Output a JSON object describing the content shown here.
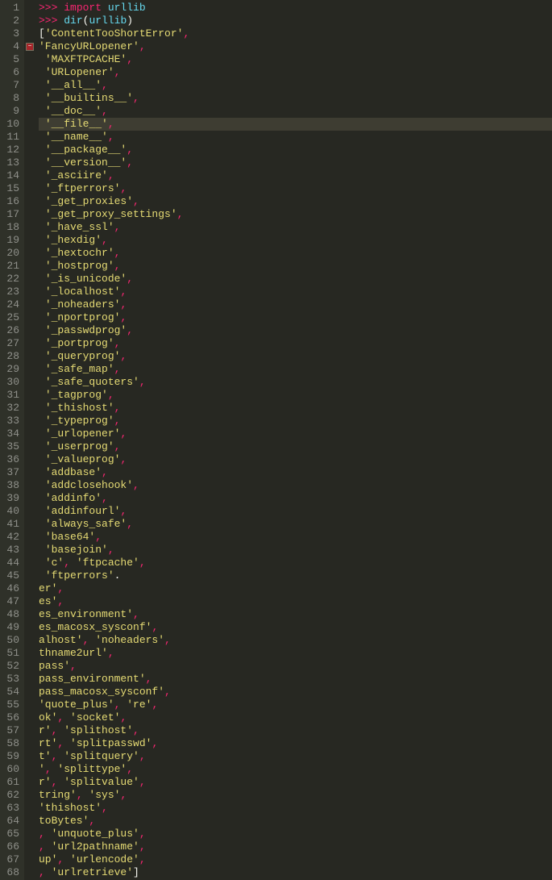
{
  "editor": {
    "highlighted_line": 10,
    "fold_marker_line": 4,
    "lines": [
      {
        "n": 1,
        "indent": 0,
        "tokens": [
          {
            "t": ">>> ",
            "c": "prompt"
          },
          {
            "t": "import ",
            "c": "keyword"
          },
          {
            "t": "urllib",
            "c": "module"
          }
        ]
      },
      {
        "n": 2,
        "indent": 0,
        "tokens": [
          {
            "t": ">>> ",
            "c": "prompt"
          },
          {
            "t": "dir",
            "c": "func"
          },
          {
            "t": "(",
            "c": "paren"
          },
          {
            "t": "urllib",
            "c": "module"
          },
          {
            "t": ")",
            "c": "paren"
          }
        ]
      },
      {
        "n": 3,
        "indent": 0,
        "tokens": [
          {
            "t": "[",
            "c": "bracket"
          },
          {
            "t": "'ContentTooShortError'",
            "c": "string"
          },
          {
            "t": ",",
            "c": "comma"
          }
        ]
      },
      {
        "n": 4,
        "indent": 0,
        "tokens": [
          {
            "t": "'FancyURLopener'",
            "c": "string"
          },
          {
            "t": ",",
            "c": "comma"
          }
        ]
      },
      {
        "n": 5,
        "indent": 1,
        "tokens": [
          {
            "t": "'MAXFTPCACHE'",
            "c": "string"
          },
          {
            "t": ",",
            "c": "comma"
          }
        ]
      },
      {
        "n": 6,
        "indent": 1,
        "tokens": [
          {
            "t": "'URLopener'",
            "c": "string"
          },
          {
            "t": ",",
            "c": "comma"
          }
        ]
      },
      {
        "n": 7,
        "indent": 1,
        "tokens": [
          {
            "t": "'__all__'",
            "c": "string"
          },
          {
            "t": ",",
            "c": "comma"
          }
        ]
      },
      {
        "n": 8,
        "indent": 1,
        "tokens": [
          {
            "t": "'__builtins__'",
            "c": "string"
          },
          {
            "t": ",",
            "c": "comma"
          }
        ]
      },
      {
        "n": 9,
        "indent": 1,
        "tokens": [
          {
            "t": "'__doc__'",
            "c": "string"
          },
          {
            "t": ",",
            "c": "comma"
          }
        ]
      },
      {
        "n": 10,
        "indent": 1,
        "tokens": [
          {
            "t": "'__file__'",
            "c": "string"
          },
          {
            "t": ",",
            "c": "comma"
          }
        ]
      },
      {
        "n": 11,
        "indent": 1,
        "tokens": [
          {
            "t": "'__name__'",
            "c": "string"
          },
          {
            "t": ",",
            "c": "comma"
          }
        ]
      },
      {
        "n": 12,
        "indent": 1,
        "tokens": [
          {
            "t": "'__package__'",
            "c": "string"
          },
          {
            "t": ",",
            "c": "comma"
          }
        ]
      },
      {
        "n": 13,
        "indent": 1,
        "tokens": [
          {
            "t": "'__version__'",
            "c": "string"
          },
          {
            "t": ",",
            "c": "comma"
          }
        ]
      },
      {
        "n": 14,
        "indent": 1,
        "tokens": [
          {
            "t": "'_asciire'",
            "c": "string"
          },
          {
            "t": ",",
            "c": "comma"
          }
        ]
      },
      {
        "n": 15,
        "indent": 1,
        "tokens": [
          {
            "t": "'_ftperrors'",
            "c": "string"
          },
          {
            "t": ",",
            "c": "comma"
          }
        ]
      },
      {
        "n": 16,
        "indent": 1,
        "tokens": [
          {
            "t": "'_get_proxies'",
            "c": "string"
          },
          {
            "t": ",",
            "c": "comma"
          }
        ]
      },
      {
        "n": 17,
        "indent": 1,
        "tokens": [
          {
            "t": "'_get_proxy_settings'",
            "c": "string"
          },
          {
            "t": ",",
            "c": "comma"
          }
        ]
      },
      {
        "n": 18,
        "indent": 1,
        "tokens": [
          {
            "t": "'_have_ssl'",
            "c": "string"
          },
          {
            "t": ",",
            "c": "comma"
          }
        ]
      },
      {
        "n": 19,
        "indent": 1,
        "tokens": [
          {
            "t": "'_hexdig'",
            "c": "string"
          },
          {
            "t": ",",
            "c": "comma"
          }
        ]
      },
      {
        "n": 20,
        "indent": 1,
        "tokens": [
          {
            "t": "'_hextochr'",
            "c": "string"
          },
          {
            "t": ",",
            "c": "comma"
          }
        ]
      },
      {
        "n": 21,
        "indent": 1,
        "tokens": [
          {
            "t": "'_hostprog'",
            "c": "string"
          },
          {
            "t": ",",
            "c": "comma"
          }
        ]
      },
      {
        "n": 22,
        "indent": 1,
        "tokens": [
          {
            "t": "'_is_unicode'",
            "c": "string"
          },
          {
            "t": ",",
            "c": "comma"
          }
        ]
      },
      {
        "n": 23,
        "indent": 1,
        "tokens": [
          {
            "t": "'_localhost'",
            "c": "string"
          },
          {
            "t": ",",
            "c": "comma"
          }
        ]
      },
      {
        "n": 24,
        "indent": 1,
        "tokens": [
          {
            "t": "'_noheaders'",
            "c": "string"
          },
          {
            "t": ",",
            "c": "comma"
          }
        ]
      },
      {
        "n": 25,
        "indent": 1,
        "tokens": [
          {
            "t": "'_nportprog'",
            "c": "string"
          },
          {
            "t": ",",
            "c": "comma"
          }
        ]
      },
      {
        "n": 26,
        "indent": 1,
        "tokens": [
          {
            "t": "'_passwdprog'",
            "c": "string"
          },
          {
            "t": ",",
            "c": "comma"
          }
        ]
      },
      {
        "n": 27,
        "indent": 1,
        "tokens": [
          {
            "t": "'_portprog'",
            "c": "string"
          },
          {
            "t": ",",
            "c": "comma"
          }
        ]
      },
      {
        "n": 28,
        "indent": 1,
        "tokens": [
          {
            "t": "'_queryprog'",
            "c": "string"
          },
          {
            "t": ",",
            "c": "comma"
          }
        ]
      },
      {
        "n": 29,
        "indent": 1,
        "tokens": [
          {
            "t": "'_safe_map'",
            "c": "string"
          },
          {
            "t": ",",
            "c": "comma"
          }
        ]
      },
      {
        "n": 30,
        "indent": 1,
        "tokens": [
          {
            "t": "'_safe_quoters'",
            "c": "string"
          },
          {
            "t": ",",
            "c": "comma"
          }
        ]
      },
      {
        "n": 31,
        "indent": 1,
        "tokens": [
          {
            "t": "'_tagprog'",
            "c": "string"
          },
          {
            "t": ",",
            "c": "comma"
          }
        ]
      },
      {
        "n": 32,
        "indent": 1,
        "tokens": [
          {
            "t": "'_thishost'",
            "c": "string"
          },
          {
            "t": ",",
            "c": "comma"
          }
        ]
      },
      {
        "n": 33,
        "indent": 1,
        "tokens": [
          {
            "t": "'_typeprog'",
            "c": "string"
          },
          {
            "t": ",",
            "c": "comma"
          }
        ]
      },
      {
        "n": 34,
        "indent": 1,
        "tokens": [
          {
            "t": "'_urlopener'",
            "c": "string"
          },
          {
            "t": ",",
            "c": "comma"
          }
        ]
      },
      {
        "n": 35,
        "indent": 1,
        "tokens": [
          {
            "t": "'_userprog'",
            "c": "string"
          },
          {
            "t": ",",
            "c": "comma"
          }
        ]
      },
      {
        "n": 36,
        "indent": 1,
        "tokens": [
          {
            "t": "'_valueprog'",
            "c": "string"
          },
          {
            "t": ",",
            "c": "comma"
          }
        ]
      },
      {
        "n": 37,
        "indent": 1,
        "tokens": [
          {
            "t": "'addbase'",
            "c": "string"
          },
          {
            "t": ",",
            "c": "comma"
          }
        ]
      },
      {
        "n": 38,
        "indent": 1,
        "tokens": [
          {
            "t": "'addclosehook'",
            "c": "string"
          },
          {
            "t": ",",
            "c": "comma"
          }
        ]
      },
      {
        "n": 39,
        "indent": 1,
        "tokens": [
          {
            "t": "'addinfo'",
            "c": "string"
          },
          {
            "t": ",",
            "c": "comma"
          }
        ]
      },
      {
        "n": 40,
        "indent": 1,
        "tokens": [
          {
            "t": "'addinfourl'",
            "c": "string"
          },
          {
            "t": ",",
            "c": "comma"
          }
        ]
      },
      {
        "n": 41,
        "indent": 1,
        "tokens": [
          {
            "t": "'always_safe'",
            "c": "string"
          },
          {
            "t": ",",
            "c": "comma"
          }
        ]
      },
      {
        "n": 42,
        "indent": 1,
        "tokens": [
          {
            "t": "'base64'",
            "c": "string"
          },
          {
            "t": ",",
            "c": "comma"
          }
        ]
      },
      {
        "n": 43,
        "indent": 1,
        "tokens": [
          {
            "t": "'basejoin'",
            "c": "string"
          },
          {
            "t": ",",
            "c": "comma"
          }
        ]
      },
      {
        "n": 44,
        "indent": 1,
        "tokens": [
          {
            "t": "'c'",
            "c": "string"
          },
          {
            "t": ", ",
            "c": "comma"
          },
          {
            "t": "'ftpcache'",
            "c": "string"
          },
          {
            "t": ",",
            "c": "comma"
          }
        ]
      },
      {
        "n": 45,
        "indent": 1,
        "tokens": [
          {
            "t": "'ftperrors'",
            "c": "string"
          },
          {
            "t": ".",
            "c": "dot"
          }
        ]
      },
      {
        "n": 46,
        "indent": 0,
        "tokens": [
          {
            "t": "er'",
            "c": "string"
          },
          {
            "t": ",",
            "c": "comma"
          }
        ]
      },
      {
        "n": 47,
        "indent": 0,
        "tokens": [
          {
            "t": "es'",
            "c": "string"
          },
          {
            "t": ",",
            "c": "comma"
          }
        ]
      },
      {
        "n": 48,
        "indent": 0,
        "tokens": [
          {
            "t": "es_environment'",
            "c": "string"
          },
          {
            "t": ",",
            "c": "comma"
          }
        ]
      },
      {
        "n": 49,
        "indent": 0,
        "tokens": [
          {
            "t": "es_macosx_sysconf'",
            "c": "string"
          },
          {
            "t": ",",
            "c": "comma"
          }
        ]
      },
      {
        "n": 50,
        "indent": 0,
        "tokens": [
          {
            "t": "alhost'",
            "c": "string"
          },
          {
            "t": ", ",
            "c": "comma"
          },
          {
            "t": "'noheaders'",
            "c": "string"
          },
          {
            "t": ",",
            "c": "comma"
          }
        ]
      },
      {
        "n": 51,
        "indent": 0,
        "tokens": [
          {
            "t": "thname2url'",
            "c": "string"
          },
          {
            "t": ",",
            "c": "comma"
          }
        ]
      },
      {
        "n": 52,
        "indent": 0,
        "tokens": [
          {
            "t": "pass'",
            "c": "string"
          },
          {
            "t": ",",
            "c": "comma"
          }
        ]
      },
      {
        "n": 53,
        "indent": 0,
        "tokens": [
          {
            "t": "pass_environment'",
            "c": "string"
          },
          {
            "t": ",",
            "c": "comma"
          }
        ]
      },
      {
        "n": 54,
        "indent": 0,
        "tokens": [
          {
            "t": "pass_macosx_sysconf'",
            "c": "string"
          },
          {
            "t": ",",
            "c": "comma"
          }
        ]
      },
      {
        "n": 55,
        "indent": 0,
        "tokens": [
          {
            "t": "'quote_plus'",
            "c": "string"
          },
          {
            "t": ", ",
            "c": "comma"
          },
          {
            "t": "'re'",
            "c": "string"
          },
          {
            "t": ",",
            "c": "comma"
          }
        ]
      },
      {
        "n": 56,
        "indent": 0,
        "tokens": [
          {
            "t": "ok'",
            "c": "string"
          },
          {
            "t": ", ",
            "c": "comma"
          },
          {
            "t": "'socket'",
            "c": "string"
          },
          {
            "t": ",",
            "c": "comma"
          }
        ]
      },
      {
        "n": 57,
        "indent": 0,
        "tokens": [
          {
            "t": "r'",
            "c": "string"
          },
          {
            "t": ", ",
            "c": "comma"
          },
          {
            "t": "'splithost'",
            "c": "string"
          },
          {
            "t": ",",
            "c": "comma"
          }
        ]
      },
      {
        "n": 58,
        "indent": 0,
        "tokens": [
          {
            "t": "rt'",
            "c": "string"
          },
          {
            "t": ", ",
            "c": "comma"
          },
          {
            "t": "'splitpasswd'",
            "c": "string"
          },
          {
            "t": ",",
            "c": "comma"
          }
        ]
      },
      {
        "n": 59,
        "indent": 0,
        "tokens": [
          {
            "t": "t'",
            "c": "string"
          },
          {
            "t": ", ",
            "c": "comma"
          },
          {
            "t": "'splitquery'",
            "c": "string"
          },
          {
            "t": ",",
            "c": "comma"
          }
        ]
      },
      {
        "n": 60,
        "indent": 0,
        "tokens": [
          {
            "t": "'",
            "c": "string"
          },
          {
            "t": ", ",
            "c": "comma"
          },
          {
            "t": "'splittype'",
            "c": "string"
          },
          {
            "t": ",",
            "c": "comma"
          }
        ]
      },
      {
        "n": 61,
        "indent": 0,
        "tokens": [
          {
            "t": "r'",
            "c": "string"
          },
          {
            "t": ", ",
            "c": "comma"
          },
          {
            "t": "'splitvalue'",
            "c": "string"
          },
          {
            "t": ",",
            "c": "comma"
          }
        ]
      },
      {
        "n": 62,
        "indent": 0,
        "tokens": [
          {
            "t": "tring'",
            "c": "string"
          },
          {
            "t": ", ",
            "c": "comma"
          },
          {
            "t": "'sys'",
            "c": "string"
          },
          {
            "t": ",",
            "c": "comma"
          }
        ]
      },
      {
        "n": 63,
        "indent": 0,
        "tokens": [
          {
            "t": "'thishost'",
            "c": "string"
          },
          {
            "t": ",",
            "c": "comma"
          }
        ]
      },
      {
        "n": 64,
        "indent": 0,
        "tokens": [
          {
            "t": "toBytes'",
            "c": "string"
          },
          {
            "t": ",",
            "c": "comma"
          }
        ]
      },
      {
        "n": 65,
        "indent": 0,
        "tokens": [
          {
            "t": ", ",
            "c": "comma"
          },
          {
            "t": "'unquote_plus'",
            "c": "string"
          },
          {
            "t": ",",
            "c": "comma"
          }
        ]
      },
      {
        "n": 66,
        "indent": 0,
        "tokens": [
          {
            "t": ", ",
            "c": "comma"
          },
          {
            "t": "'url2pathname'",
            "c": "string"
          },
          {
            "t": ",",
            "c": "comma"
          }
        ]
      },
      {
        "n": 67,
        "indent": 0,
        "tokens": [
          {
            "t": "up'",
            "c": "string"
          },
          {
            "t": ", ",
            "c": "comma"
          },
          {
            "t": "'urlencode'",
            "c": "string"
          },
          {
            "t": ",",
            "c": "comma"
          }
        ]
      },
      {
        "n": 68,
        "indent": 0,
        "tokens": [
          {
            "t": ", ",
            "c": "comma"
          },
          {
            "t": "'urlretrieve'",
            "c": "string"
          },
          {
            "t": "]",
            "c": "bracket"
          }
        ]
      }
    ]
  }
}
